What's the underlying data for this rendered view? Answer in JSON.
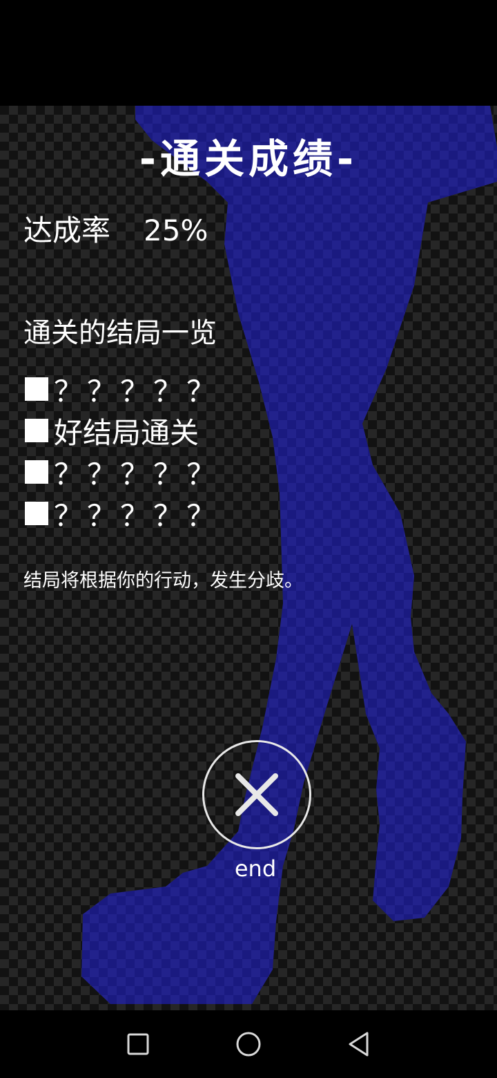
{
  "result_screen": {
    "title": "-通关成绩-",
    "rate_label": "达成率",
    "rate_value": "25%",
    "endings_heading": "通关的结局一览",
    "endings": [
      {
        "label": "？？？？？",
        "unlocked": false
      },
      {
        "label": "好结局通关",
        "unlocked": true
      },
      {
        "label": "？？？？？",
        "unlocked": false
      },
      {
        "label": "？？？？？",
        "unlocked": false
      }
    ],
    "note": "结局将根据你的行动，发生分歧。",
    "end_button_label": "end"
  },
  "icons": {
    "end_button": "close-x-icon",
    "nav_recent": "square-icon",
    "nav_home": "circle-icon",
    "nav_back": "triangle-back-icon"
  },
  "colors": {
    "silhouette": "#1a1a80",
    "text": "#ffffff",
    "checker_light": "#262626",
    "checker_dark": "#121212"
  }
}
